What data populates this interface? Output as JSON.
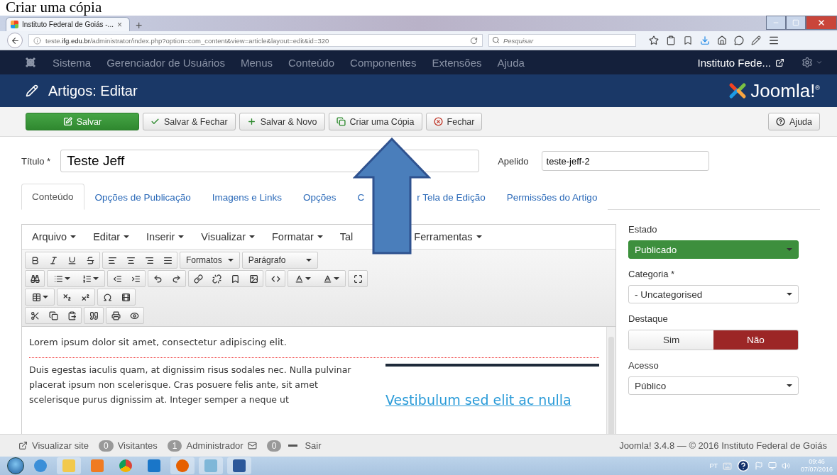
{
  "caption": "Criar uma cópia",
  "browser": {
    "tab": {
      "title": "Instituto Federal de Goiás -...",
      "close": "×"
    },
    "new_tab": "+",
    "url": "teste.**ifg.edu.br**/administrator/index.php?option=com_content&view=article&layout=edit&id=320",
    "search": {
      "placeholder": "Pesquisar"
    }
  },
  "navbar": {
    "items": [
      "Sistema",
      "Gerenciador de Usuários",
      "Menus",
      "Conteúdo",
      "Componentes",
      "Extensões",
      "Ajuda"
    ],
    "site": "Instituto Fede..."
  },
  "header": {
    "title": "Artigos: Editar",
    "logo": "Joomla!$^{®}$"
  },
  "toolbar": {
    "buttons": [
      {
        "label": "Salvar",
        "kind": "save"
      },
      {
        "label": "Salvar & Fechar",
        "kind": "check"
      },
      {
        "label": "Salvar & Novo",
        "kind": "new"
      },
      {
        "label": "Criar uma Cópia",
        "kind": "copy"
      },
      {
        "label": "Fechar",
        "kind": "close"
      }
    ],
    "help": "Ajuda"
  },
  "form": {
    "title": {
      "label": "Título *",
      "value": "Teste Jeff"
    },
    "alias": {
      "label": "Apelido",
      "value": "teste-jeff-2"
    }
  },
  "tabs": [
    {
      "label": "Conteúdo",
      "selected": true
    },
    {
      "label": "Opções de Publicação",
      "selected": false
    },
    {
      "label": "Imagens e Links",
      "selected": false
    },
    {
      "label": "Opções",
      "selected": false
    },
    {
      "label": "C",
      "label_after": "r Tela de Edição",
      "selected": false
    },
    {
      "label": "Permissões do Artigo",
      "selected": false
    }
  ],
  "editor": {
    "menu": [
      {
        "label": "Arquivo",
        "dropdown": true
      },
      {
        "label": "Editar",
        "dropdown": true
      },
      {
        "label": "Inserir",
        "dropdown": true
      },
      {
        "label": "Visualizar",
        "dropdown": true
      },
      {
        "label": "Formatar",
        "dropdown": true
      },
      {
        "label": "Tal",
        "dropdown": false
      },
      {
        "label": "Ferramentas",
        "dropdown": true
      }
    ],
    "formats": "Formatos",
    "block": "Parágrafo",
    "lead": "Lorem ipsum dolor sit amet, consectetur adipiscing elit.",
    "paragraph": "Duis egestas iaculis quam, at dignissim risus sodales nec. Nulla pulvinar placerat ipsum non scelerisque. Cras posuere felis ante, sit amet scelerisque purus dignissim at. Integer semper a neque ut",
    "link": "Vestibulum sed elit ac nulla"
  },
  "sidebar": {
    "fields": [
      {
        "kind": "select",
        "label": "Estado",
        "value": "Publicado",
        "highlighted": true
      },
      {
        "kind": "select",
        "label": "Categoria *",
        "value": "- Uncategorised",
        "highlighted": false
      },
      {
        "kind": "toggle",
        "label": "Destaque",
        "options": [
          {
            "label": "Sim",
            "selected": false
          },
          {
            "label": "Não",
            "selected": true
          }
        ]
      },
      {
        "kind": "select",
        "label": "Acesso",
        "value": "Público",
        "highlighted": false
      }
    ]
  },
  "footer": {
    "view_site": "Visualizar site",
    "visitors": {
      "count": "0",
      "label": "Visitantes"
    },
    "admins": {
      "count": "1",
      "label": "Administrador"
    },
    "messages": "0",
    "logout": "Sair",
    "credit": "Joomla! 3.4.8 — © 2016 Instituto Federal de Goiás"
  },
  "taskbar": {
    "language": "PT",
    "time": "09:46",
    "date": "07/07/2016"
  }
}
